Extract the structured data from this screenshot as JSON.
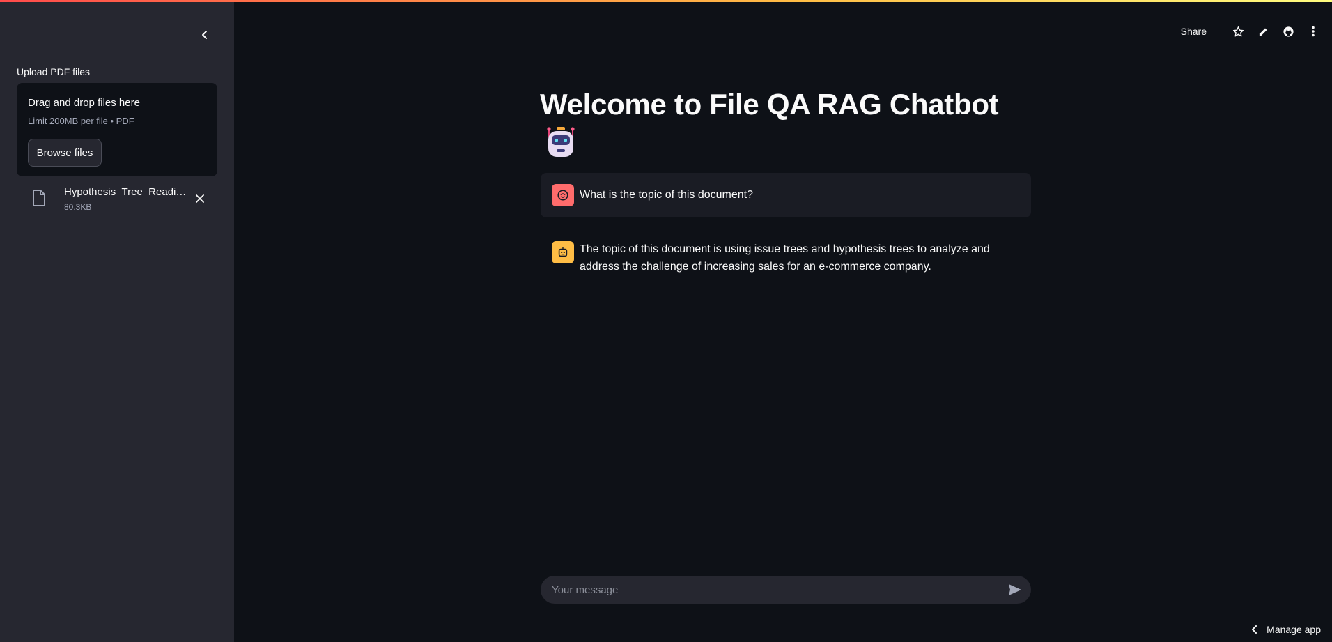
{
  "sidebar": {
    "collapse_icon": "chevron-left-icon",
    "upload_label": "Upload PDF files",
    "dropzone": {
      "title": "Drag and drop files here",
      "subtitle": "Limit 200MB per file • PDF",
      "browse_label": "Browse files"
    },
    "file": {
      "name": "Hypothesis_Tree_Readin...",
      "size": "80.3KB",
      "icon": "file-icon",
      "remove_icon": "close-icon"
    }
  },
  "header": {
    "share_label": "Share",
    "icons": [
      "star-icon",
      "edit-icon",
      "github-icon",
      "more-vertical-icon"
    ]
  },
  "main": {
    "title": "Welcome to File QA RAG Chatbot",
    "title_emoji": "robot-emoji",
    "messages": [
      {
        "role": "user",
        "text": "What is the topic of this document?"
      },
      {
        "role": "assistant",
        "text": "The topic of this document is using issue trees and hypothesis trees to analyze and address the challenge of increasing sales for an e-commerce company."
      }
    ],
    "input_placeholder": "Your message",
    "send_icon": "send-icon"
  },
  "footer": {
    "manage_label": "Manage app"
  },
  "colors": {
    "background": "#0e1117",
    "sidebar": "#262730",
    "user_avatar": "#ff6c6c",
    "bot_avatar": "#ffbd45",
    "accent_gradient_start": "#ff4b4b",
    "accent_gradient_end": "#fffd80"
  }
}
